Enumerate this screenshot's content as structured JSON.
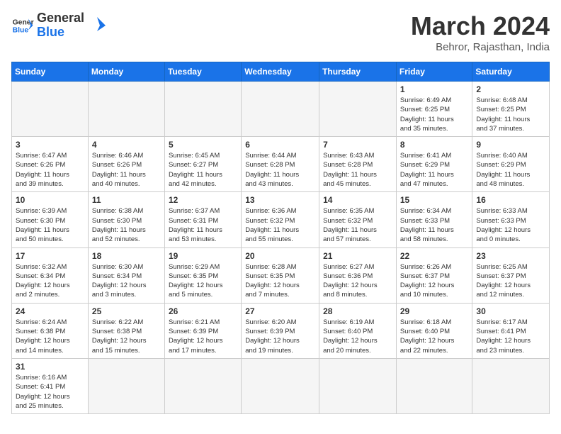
{
  "logo": {
    "text_general": "General",
    "text_blue": "Blue"
  },
  "header": {
    "month_year": "March 2024",
    "location": "Behror, Rajasthan, India"
  },
  "days_of_week": [
    "Sunday",
    "Monday",
    "Tuesday",
    "Wednesday",
    "Thursday",
    "Friday",
    "Saturday"
  ],
  "weeks": [
    [
      {
        "day": "",
        "info": ""
      },
      {
        "day": "",
        "info": ""
      },
      {
        "day": "",
        "info": ""
      },
      {
        "day": "",
        "info": ""
      },
      {
        "day": "",
        "info": ""
      },
      {
        "day": "1",
        "info": "Sunrise: 6:49 AM\nSunset: 6:25 PM\nDaylight: 11 hours\nand 35 minutes."
      },
      {
        "day": "2",
        "info": "Sunrise: 6:48 AM\nSunset: 6:25 PM\nDaylight: 11 hours\nand 37 minutes."
      }
    ],
    [
      {
        "day": "3",
        "info": "Sunrise: 6:47 AM\nSunset: 6:26 PM\nDaylight: 11 hours\nand 39 minutes."
      },
      {
        "day": "4",
        "info": "Sunrise: 6:46 AM\nSunset: 6:26 PM\nDaylight: 11 hours\nand 40 minutes."
      },
      {
        "day": "5",
        "info": "Sunrise: 6:45 AM\nSunset: 6:27 PM\nDaylight: 11 hours\nand 42 minutes."
      },
      {
        "day": "6",
        "info": "Sunrise: 6:44 AM\nSunset: 6:28 PM\nDaylight: 11 hours\nand 43 minutes."
      },
      {
        "day": "7",
        "info": "Sunrise: 6:43 AM\nSunset: 6:28 PM\nDaylight: 11 hours\nand 45 minutes."
      },
      {
        "day": "8",
        "info": "Sunrise: 6:41 AM\nSunset: 6:29 PM\nDaylight: 11 hours\nand 47 minutes."
      },
      {
        "day": "9",
        "info": "Sunrise: 6:40 AM\nSunset: 6:29 PM\nDaylight: 11 hours\nand 48 minutes."
      }
    ],
    [
      {
        "day": "10",
        "info": "Sunrise: 6:39 AM\nSunset: 6:30 PM\nDaylight: 11 hours\nand 50 minutes."
      },
      {
        "day": "11",
        "info": "Sunrise: 6:38 AM\nSunset: 6:30 PM\nDaylight: 11 hours\nand 52 minutes."
      },
      {
        "day": "12",
        "info": "Sunrise: 6:37 AM\nSunset: 6:31 PM\nDaylight: 11 hours\nand 53 minutes."
      },
      {
        "day": "13",
        "info": "Sunrise: 6:36 AM\nSunset: 6:32 PM\nDaylight: 11 hours\nand 55 minutes."
      },
      {
        "day": "14",
        "info": "Sunrise: 6:35 AM\nSunset: 6:32 PM\nDaylight: 11 hours\nand 57 minutes."
      },
      {
        "day": "15",
        "info": "Sunrise: 6:34 AM\nSunset: 6:33 PM\nDaylight: 11 hours\nand 58 minutes."
      },
      {
        "day": "16",
        "info": "Sunrise: 6:33 AM\nSunset: 6:33 PM\nDaylight: 12 hours\nand 0 minutes."
      }
    ],
    [
      {
        "day": "17",
        "info": "Sunrise: 6:32 AM\nSunset: 6:34 PM\nDaylight: 12 hours\nand 2 minutes."
      },
      {
        "day": "18",
        "info": "Sunrise: 6:30 AM\nSunset: 6:34 PM\nDaylight: 12 hours\nand 3 minutes."
      },
      {
        "day": "19",
        "info": "Sunrise: 6:29 AM\nSunset: 6:35 PM\nDaylight: 12 hours\nand 5 minutes."
      },
      {
        "day": "20",
        "info": "Sunrise: 6:28 AM\nSunset: 6:35 PM\nDaylight: 12 hours\nand 7 minutes."
      },
      {
        "day": "21",
        "info": "Sunrise: 6:27 AM\nSunset: 6:36 PM\nDaylight: 12 hours\nand 8 minutes."
      },
      {
        "day": "22",
        "info": "Sunrise: 6:26 AM\nSunset: 6:37 PM\nDaylight: 12 hours\nand 10 minutes."
      },
      {
        "day": "23",
        "info": "Sunrise: 6:25 AM\nSunset: 6:37 PM\nDaylight: 12 hours\nand 12 minutes."
      }
    ],
    [
      {
        "day": "24",
        "info": "Sunrise: 6:24 AM\nSunset: 6:38 PM\nDaylight: 12 hours\nand 14 minutes."
      },
      {
        "day": "25",
        "info": "Sunrise: 6:22 AM\nSunset: 6:38 PM\nDaylight: 12 hours\nand 15 minutes."
      },
      {
        "day": "26",
        "info": "Sunrise: 6:21 AM\nSunset: 6:39 PM\nDaylight: 12 hours\nand 17 minutes."
      },
      {
        "day": "27",
        "info": "Sunrise: 6:20 AM\nSunset: 6:39 PM\nDaylight: 12 hours\nand 19 minutes."
      },
      {
        "day": "28",
        "info": "Sunrise: 6:19 AM\nSunset: 6:40 PM\nDaylight: 12 hours\nand 20 minutes."
      },
      {
        "day": "29",
        "info": "Sunrise: 6:18 AM\nSunset: 6:40 PM\nDaylight: 12 hours\nand 22 minutes."
      },
      {
        "day": "30",
        "info": "Sunrise: 6:17 AM\nSunset: 6:41 PM\nDaylight: 12 hours\nand 23 minutes."
      }
    ],
    [
      {
        "day": "31",
        "info": "Sunrise: 6:16 AM\nSunset: 6:41 PM\nDaylight: 12 hours\nand 25 minutes."
      },
      {
        "day": "",
        "info": ""
      },
      {
        "day": "",
        "info": ""
      },
      {
        "day": "",
        "info": ""
      },
      {
        "day": "",
        "info": ""
      },
      {
        "day": "",
        "info": ""
      },
      {
        "day": "",
        "info": ""
      }
    ]
  ]
}
